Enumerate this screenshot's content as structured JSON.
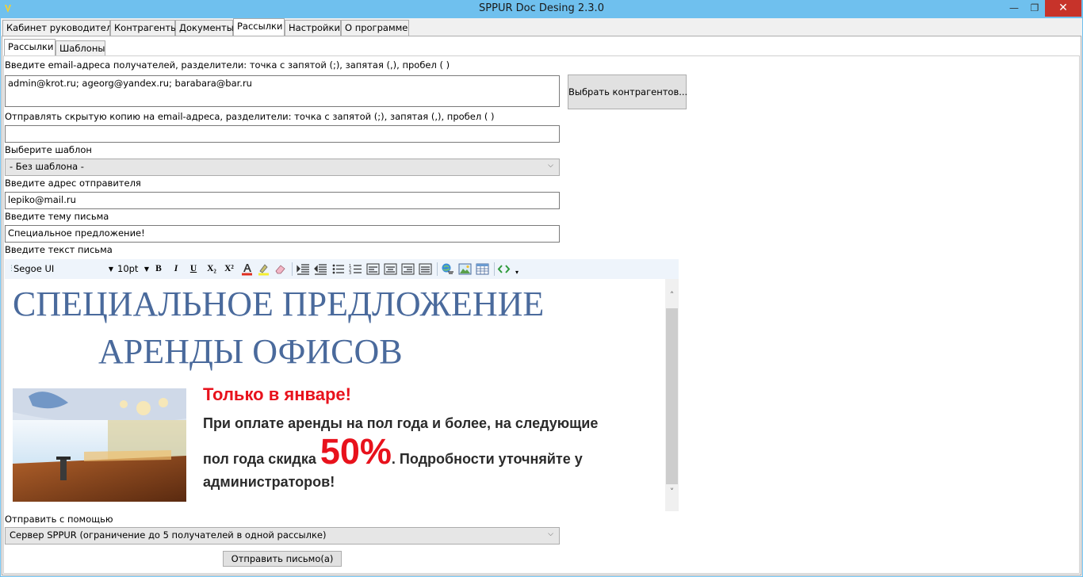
{
  "window": {
    "title": "SPPUR Doc Desing 2.3.0",
    "minimize": "🗕",
    "maximize": "🗗",
    "close": "✕"
  },
  "main_tabs": [
    {
      "label": "Кабинет руководителя",
      "active": false
    },
    {
      "label": "Контрагенты",
      "active": false
    },
    {
      "label": "Документы",
      "active": false
    },
    {
      "label": "Рассылки",
      "active": true
    },
    {
      "label": "Настройки",
      "active": false
    },
    {
      "label": "О программе",
      "active": false
    }
  ],
  "sub_tabs": [
    {
      "label": "Рассылки",
      "active": true
    },
    {
      "label": "Шаблоны",
      "active": false
    }
  ],
  "form": {
    "recipients_label": "Введите email-адреса получателей, разделители: точка с запятой (;), запятая (,), пробел ( )",
    "recipients_value": "admin@krot.ru; ageorg@yandex.ru; barabara@bar.ru",
    "choose_contractors_button": "Выбрать контрагентов...",
    "bcc_label": "Отправлять скрытую копию на email-адреса, разделители: точка с запятой (;), запятая (,), пробел ( )",
    "bcc_value": "",
    "template_label": "Выберите шаблон",
    "template_value": "- Без шаблона -",
    "sender_label": "Введите адрес отправителя",
    "sender_value": "lepiko@mail.ru",
    "subject_label": "Введите тему письма",
    "subject_value": "Специальное предложение!",
    "body_label": "Введите текст письма",
    "send_via_label": "Отправить с помощью",
    "send_via_value": "Сервер SPPUR (ограничение до 5 получателей в одной рассылке)",
    "send_button": "Отправить письмо(а)"
  },
  "toolbar": {
    "font_name": "Segoe UI",
    "font_size": "10pt",
    "bold": "B",
    "italic": "I",
    "underline": "U",
    "subscript": "X₂",
    "superscript": "X²",
    "icons": [
      "font-color-icon",
      "highlight-icon",
      "eraser-icon",
      "indent-decrease-icon",
      "indent-increase-icon",
      "bullet-list-icon",
      "numbered-list-icon",
      "align-left-icon",
      "align-center-icon",
      "align-right-icon",
      "justify-icon",
      "link-icon",
      "image-icon",
      "table-icon",
      "html-source-icon"
    ]
  },
  "editor": {
    "headline_line1": "СПЕЦИАЛЬНОЕ ПРЕДЛОЖЕНИЕ",
    "headline_line2": "АРЕНДЫ ОФИСОВ",
    "promo_title": "Только в январе!",
    "promo_line1": "При оплате аренды на пол года и более, на следующие",
    "promo_line2_a": "пол года скидка ",
    "promo_pct": "50%",
    "promo_line2_b": ". Подробности уточняйте у",
    "promo_line3": " администраторов!"
  },
  "colors": {
    "titlebar": "#6fc0ee",
    "close": "#c7332a",
    "headline": "#4a6a9c",
    "promo_red": "#e8121c"
  }
}
